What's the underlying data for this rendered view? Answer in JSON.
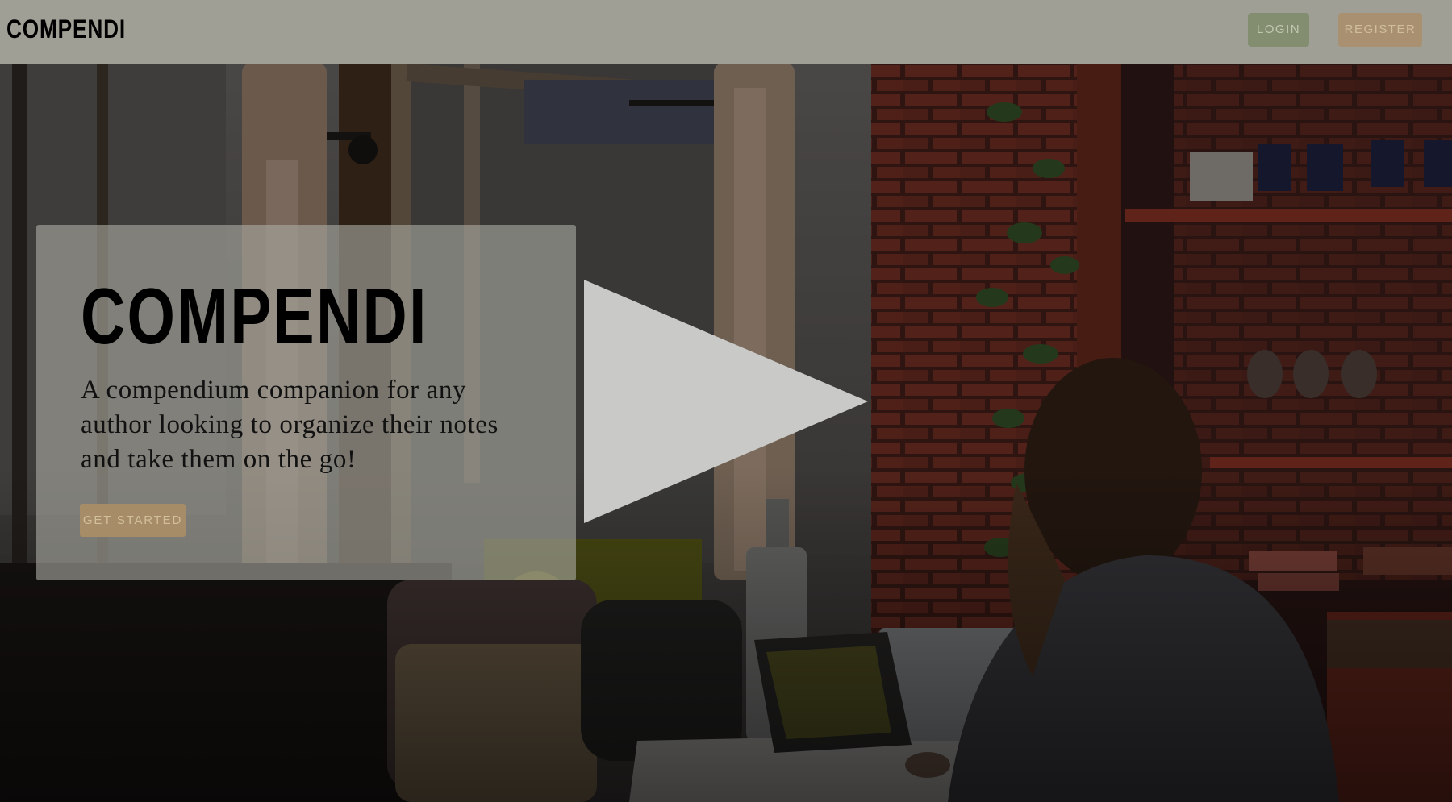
{
  "navbar": {
    "brand": "COMPENDI",
    "login_label": "LOGIN",
    "register_label": "REGISTER"
  },
  "hero": {
    "title": "COMPENDI",
    "subtitle": "A compendium companion for any author looking to organize their notes and take them on the go!",
    "cta_label": "GET STARTED"
  },
  "media": {
    "play_icon": "play-icon",
    "background": "coffee-shop-photo"
  },
  "colors": {
    "navbar_bg": "#a09f95",
    "login_bg": "#828e6f",
    "register_bg": "#a89070",
    "cta_bg": "#a78c68",
    "card_bg": "#aaaaa2"
  }
}
